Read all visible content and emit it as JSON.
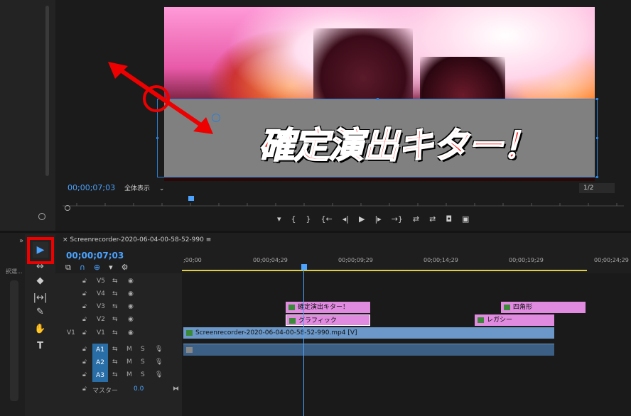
{
  "monitor": {
    "timecode": "00;00;07;03",
    "zoom_label": "全体表示",
    "zoom_caret": "⌄",
    "resolution": "1/2",
    "title_overlay": "確定演出キター！",
    "transport": [
      "▾",
      "{",
      "}",
      "{←",
      "◂|",
      "▶",
      "|▸",
      "→}",
      "⇄",
      "⇄",
      "◘",
      "▣"
    ]
  },
  "timeline": {
    "tab_close": "×",
    "sequence_name": "Screenrecorder-2020-06-04-00-58-52-990",
    "tab_menu": "≡",
    "timecode": "00;00;07;03",
    "ruler_labels": [
      ";00;00",
      "00;00;04;29",
      "00;00;09;29",
      "00;00;14;29",
      "00;00;19;29",
      "00;00;24;29"
    ],
    "video_tracks": [
      {
        "name": "V5",
        "src": ""
      },
      {
        "name": "V4",
        "src": ""
      },
      {
        "name": "V3",
        "src": ""
      },
      {
        "name": "V2",
        "src": ""
      },
      {
        "name": "V1",
        "src": "V1"
      }
    ],
    "audio_tracks": [
      {
        "name": "A1",
        "m": "M",
        "s": "S"
      },
      {
        "name": "A2",
        "m": "M",
        "s": "S"
      },
      {
        "name": "A3",
        "m": "M",
        "s": "S"
      }
    ],
    "master_label": "マスター",
    "master_value": "0.0",
    "clips": {
      "v3_a": "確定演出キター！",
      "v3_b": "四角形",
      "v2_a": "グラフィック",
      "v2_b": "レガシー",
      "v1": "Screenrecorder-2020-06-04-00-58-52-990.mp4 [V]"
    },
    "side_label": "択選..."
  },
  "tools": [
    "▶",
    "⇔",
    "◆",
    "|↔|",
    "✎",
    "✋",
    "T"
  ]
}
